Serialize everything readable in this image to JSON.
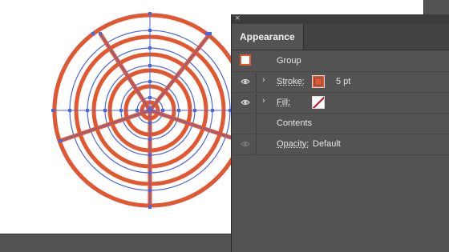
{
  "panel": {
    "close_glyph": "×",
    "tab_title": "Appearance",
    "group_label": "Group",
    "stroke_label": "Stroke:",
    "stroke_weight": "5 pt",
    "stroke_color": "#e4572e",
    "fill_label": "Fill:",
    "fill_state": "none",
    "contents_label": "Contents",
    "opacity_label": "Opacity:",
    "opacity_value": "Default"
  },
  "icons": {
    "visibility": "eye-icon",
    "expand": "chevron-right-icon"
  },
  "artwork": {
    "stroke_color": "#e4572e",
    "path_outline_color": "#4a66e0",
    "rings": 7,
    "spokes": 5
  },
  "colors": {
    "panel_bg": "#535353",
    "artboard_bg": "#ffffff",
    "accent": "#e4572e",
    "selection": "#4a66e0"
  }
}
